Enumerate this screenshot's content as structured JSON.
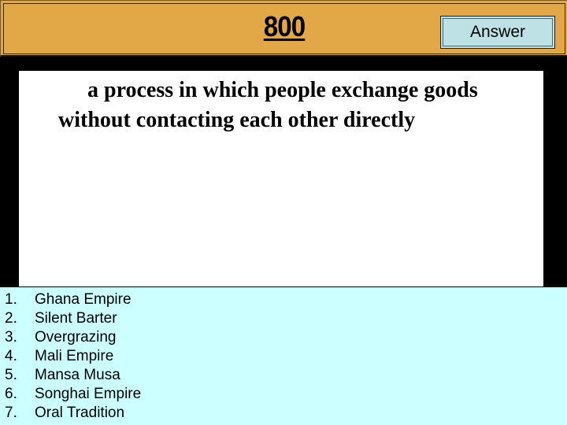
{
  "header": {
    "points": "800",
    "answer_button": "Answer"
  },
  "question": {
    "text": "a process in which people exchange goods without contacting each other directly"
  },
  "options": [
    {
      "num": "1.",
      "label": "Ghana Empire"
    },
    {
      "num": "2.",
      "label": "Silent Barter"
    },
    {
      "num": "3.",
      "label": "Overgrazing"
    },
    {
      "num": "4.",
      "label": "Mali Empire"
    },
    {
      "num": "5.",
      "label": "Mansa Musa"
    },
    {
      "num": "6.",
      "label": "Songhai Empire"
    },
    {
      "num": "7.",
      "label": "Oral Tradition"
    }
  ],
  "colors": {
    "header_bg": "#E2A848",
    "answer_button_bg": "#BEE1E6",
    "options_panel_bg": "#CCFFFF",
    "question_box_bg": "#FFFFFF",
    "background": "#000000"
  }
}
